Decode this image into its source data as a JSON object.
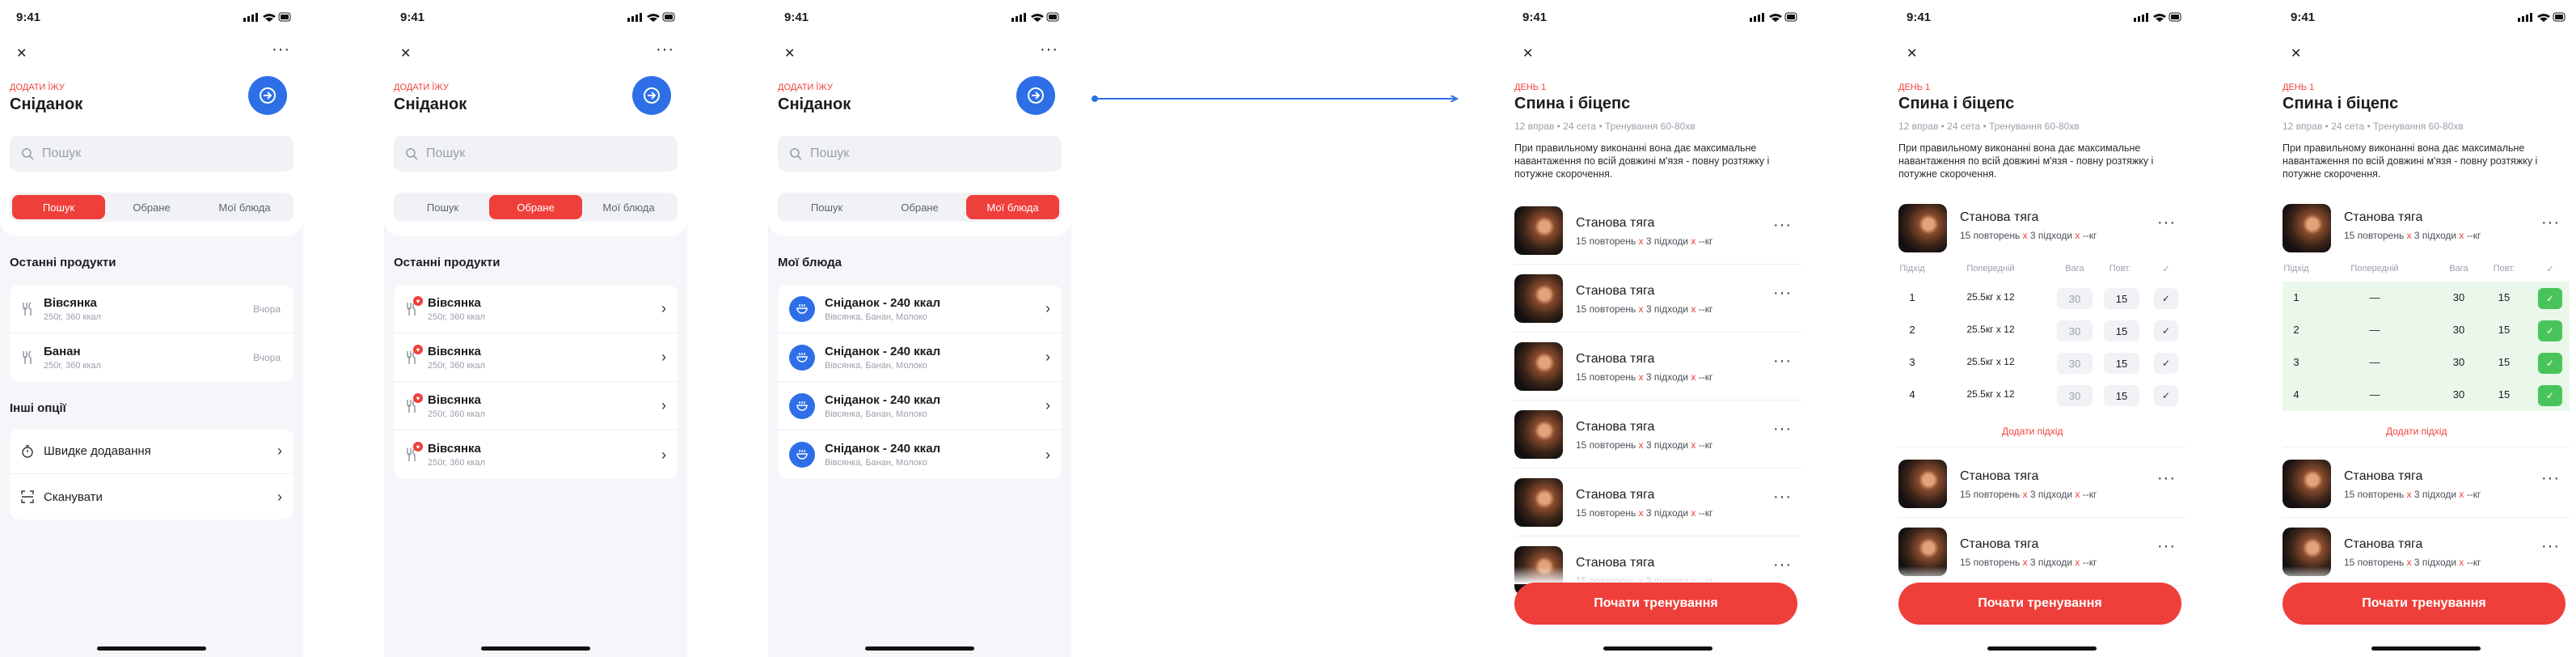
{
  "status": {
    "time": "9:41"
  },
  "food": {
    "caption": "ДОДАТИ ЇЖУ",
    "title": "Сніданок",
    "search_placeholder": "Пошук",
    "tabs": [
      "Пошук",
      "Обране",
      "Мої блюда"
    ],
    "recent_title": "Останні продукти",
    "recent": [
      {
        "name": "Вівсянка",
        "detail": "250г, 360 ккал",
        "when": "Вчора"
      },
      {
        "name": "Банан",
        "detail": "250г, 360 ккал",
        "when": "Вчора"
      }
    ],
    "other_title": "Інші опції",
    "options": [
      {
        "label": "Швидке додавання"
      },
      {
        "label": "Сканувати"
      }
    ],
    "favorites": [
      {
        "name": "Вівсянка",
        "detail": "250г, 360 ккал"
      },
      {
        "name": "Вівсянка",
        "detail": "250г, 360 ккал"
      },
      {
        "name": "Вівсянка",
        "detail": "250г, 360 ккал"
      },
      {
        "name": "Вівсянка",
        "detail": "250г, 360 ккал"
      }
    ],
    "dishes_title": "Мої блюда",
    "dishes": [
      {
        "name": "Сніданок - 240 ккал",
        "detail": "Вівсянка, Банан, Молоко"
      },
      {
        "name": "Сніданок - 240 ккал",
        "detail": "Вівсянка, Банан, Молоко"
      },
      {
        "name": "Сніданок - 240 ккал",
        "detail": "Вівсянка, Банан, Молоко"
      },
      {
        "name": "Сніданок - 240 ккал",
        "detail": "Вівсянка, Банан, Молоко"
      }
    ]
  },
  "workout": {
    "day": "ДЕНЬ 1",
    "title": "Спина і біцепс",
    "meta": "12 вправ • 24 сета • Тренування 60-80хв",
    "description": "При правильному виконанні вона дає максимальне навантаження по всій довжині м'язя - повну розтяжку і потужне скорочення.",
    "exercise": {
      "name": "Станова тяга",
      "reps": "15 повторень",
      "x": "x",
      "sets": "3 підходи",
      "weight": "--кг"
    },
    "table_headers": [
      "Підхід",
      "Попередній",
      "Вага",
      "Повт.",
      "✓"
    ],
    "sets": [
      {
        "n": "1",
        "prev": "25.5кг x 12",
        "weight": "30",
        "reps": "15"
      },
      {
        "n": "2",
        "prev": "25.5кг x 12",
        "weight": "30",
        "reps": "15"
      },
      {
        "n": "3",
        "prev": "25.5кг x 12",
        "weight": "30",
        "reps": "15"
      },
      {
        "n": "4",
        "prev": "25.5кг x 12",
        "weight": "30",
        "reps": "15"
      }
    ],
    "prev_empty": "—",
    "add_set": "Додати підхід",
    "start": "Почати тренування"
  },
  "colors": {
    "accent": "#ef3f3a",
    "blue": "#2e6fe8",
    "done": "#48c45a"
  }
}
